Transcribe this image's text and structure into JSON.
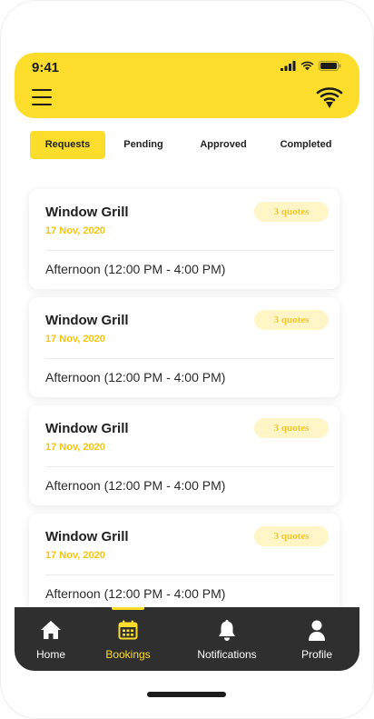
{
  "status_bar": {
    "time": "9:41"
  },
  "tabs": [
    {
      "label": "Requests",
      "active": true
    },
    {
      "label": "Pending",
      "active": false
    },
    {
      "label": "Approved",
      "active": false
    },
    {
      "label": "Completed",
      "active": false
    }
  ],
  "bookings": [
    {
      "title": "Window Grill",
      "date": "17 Nov, 2020",
      "quotes": "3 quotes",
      "slot": "Afternoon (12:00 PM - 4:00 PM)"
    },
    {
      "title": "Window Grill",
      "date": "17 Nov, 2020",
      "quotes": "3 quotes",
      "slot": "Afternoon (12:00 PM - 4:00 PM)"
    },
    {
      "title": "Window Grill",
      "date": "17 Nov, 2020",
      "quotes": "3 quotes",
      "slot": "Afternoon (12:00 PM - 4:00 PM)"
    },
    {
      "title": "Window Grill",
      "date": "17 Nov, 2020",
      "quotes": "3 quotes",
      "slot": "Afternoon (12:00 PM - 4:00 PM)"
    }
  ],
  "bottom_nav": [
    {
      "label": "Home",
      "icon": "home-icon",
      "active": false
    },
    {
      "label": "Bookings",
      "icon": "calendar-icon",
      "active": true
    },
    {
      "label": "Notifications",
      "icon": "bell-icon",
      "active": false
    },
    {
      "label": "Profile",
      "icon": "user-icon",
      "active": false
    }
  ],
  "colors": {
    "accent": "#fddd2b",
    "accent_text": "#f4c415",
    "badge_bg": "#fff5c6",
    "nav_bg": "#2f2f2f"
  }
}
